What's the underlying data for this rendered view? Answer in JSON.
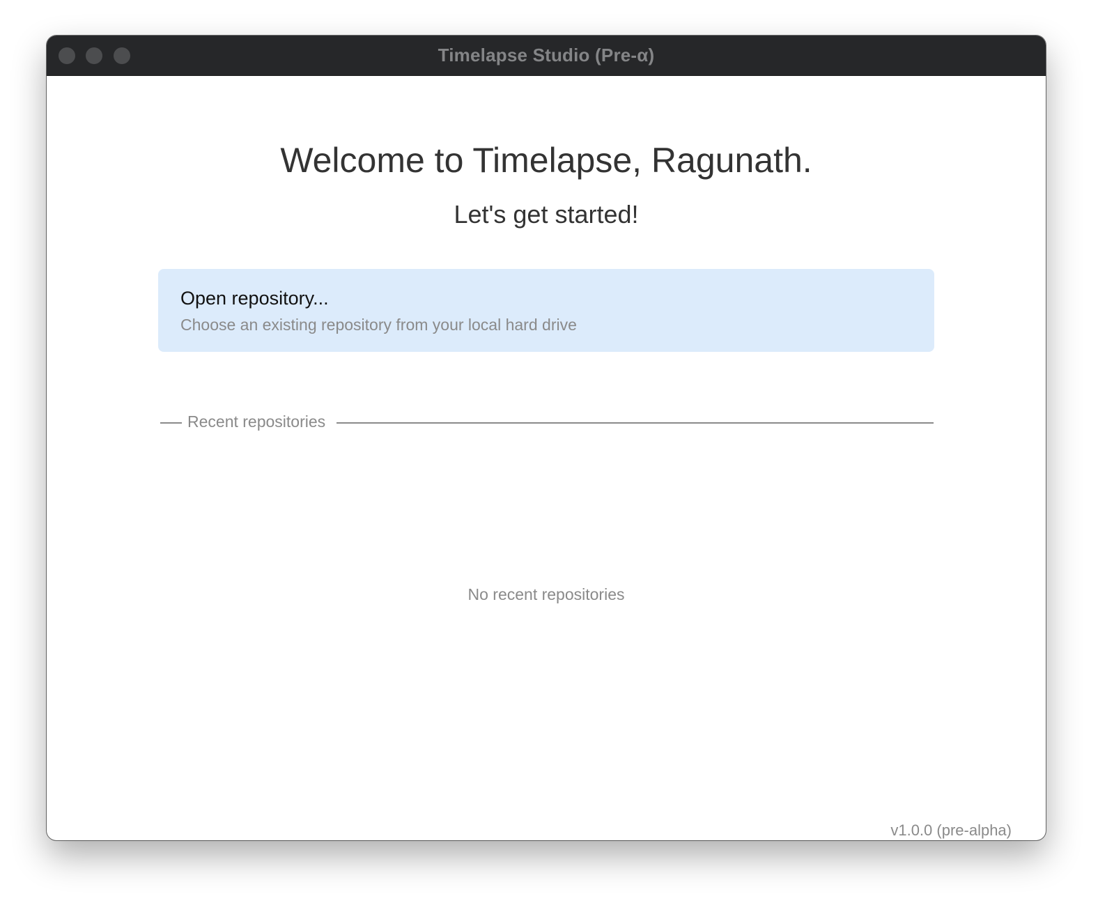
{
  "window": {
    "title": "Timelapse Studio (Pre-α)"
  },
  "welcome": {
    "heading": "Welcome to Timelapse, Ragunath.",
    "subheading": "Let's get started!"
  },
  "open_repository": {
    "title": "Open repository...",
    "description": "Choose an existing repository from your local hard drive"
  },
  "recent": {
    "section_label": "Recent repositories",
    "empty_message": "No recent repositories"
  },
  "footer": {
    "version": "v1.0.0 (pre-alpha)"
  },
  "colors": {
    "titlebar": "#262729",
    "card_background": "#dcebfb",
    "muted_text": "#8a8a8a",
    "heading_text": "#333333"
  }
}
